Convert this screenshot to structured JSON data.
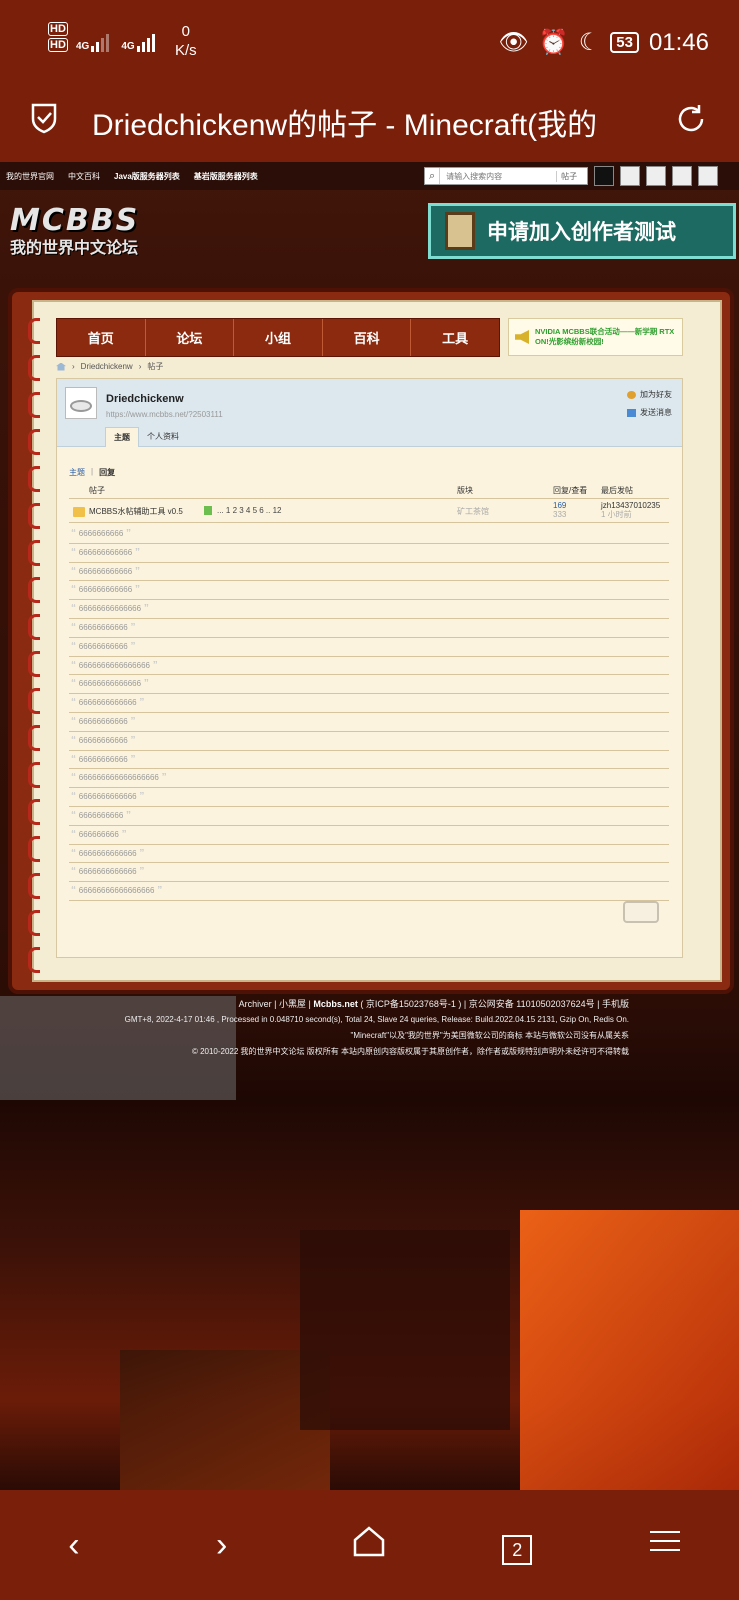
{
  "status": {
    "hd1": "HD",
    "hd2": "HD",
    "sim1": "4G",
    "sim2": "4G",
    "speed_value": "0",
    "speed_unit": "K/s",
    "battery": "53",
    "time": "01:46"
  },
  "browser": {
    "title": "Driedchickenw的帖子 - Minecraft(我的",
    "tab_count": "2"
  },
  "topnav": {
    "links": [
      "我的世界官网",
      "中文百科",
      "Java版服务器列表",
      "基岩版服务器列表"
    ],
    "search_placeholder": "请输入搜索内容",
    "search_type": "帖子"
  },
  "header": {
    "logo_big": "MCBBS",
    "logo_small": "我的世界中文论坛",
    "banner": "申请加入创作者测试"
  },
  "nav": {
    "items": [
      "首页",
      "论坛",
      "小组",
      "百科",
      "工具"
    ],
    "announcement": "NVIDIA MCBBS联合活动——新学期 RTX ON!光影缤纷新校园!"
  },
  "breadcrumb": {
    "user": "Driedchickenw",
    "section": "帖子"
  },
  "profile": {
    "name": "Driedchickenw",
    "url": "https://www.mcbbs.net/?2503111",
    "add_friend": "加为好友",
    "send_message": "发送消息",
    "tab_topics": "主题",
    "tab_info": "个人资料"
  },
  "list": {
    "subtab_topics": "主题",
    "subtab_replies": "回复",
    "headers": {
      "post": "帖子",
      "forum": "版块",
      "reply_view": "回复/查看",
      "last_post": "最后发帖"
    },
    "thread": {
      "title": "MCBBS水帖辅助工具 v0.5",
      "pages": "...  1  2  3  4  5  6 ..  12",
      "forum": "矿工茶馆",
      "replies": "169",
      "views": "333",
      "last_user": "jzh13437010235",
      "last_time": "1 小时前"
    },
    "replies": [
      "6666666666",
      "666666666666",
      "666666666666",
      "666666666666",
      "66666666666666",
      "66666666666",
      "66666666666",
      "6666666666666666",
      "66666666666666",
      "6666666666666",
      "66666666666",
      "66666666666",
      "66666666666",
      "666666666666666666",
      "6666666666666",
      "6666666666",
      "666666666",
      "6666666666666",
      "6666666666666",
      "66666666666666666"
    ]
  },
  "footer": {
    "line1_pre": "Archiver | 小黑屋 | ",
    "line1_bold": "Mcbbs.net",
    "line1_post": " ( 京ICP备15023768号-1 ) | 京公网安备 11010502037624号 | 手机版",
    "line2": "GMT+8, 2022-4-17 01:46 , Processed in 0.048710 second(s), Total 24, Slave 24 queries, Release: Build.2022.04.15 2131, Gzip On, Redis On.",
    "line3": "\"Minecraft\"以及\"我的世界\"为美国微软公司的商标 本站与微软公司没有从属关系",
    "line4": "© 2010-2022 我的世界中文论坛 版权所有 本站内原创内容版权属于其原创作者，除作者或版规特别声明外未经许可不得转载"
  }
}
